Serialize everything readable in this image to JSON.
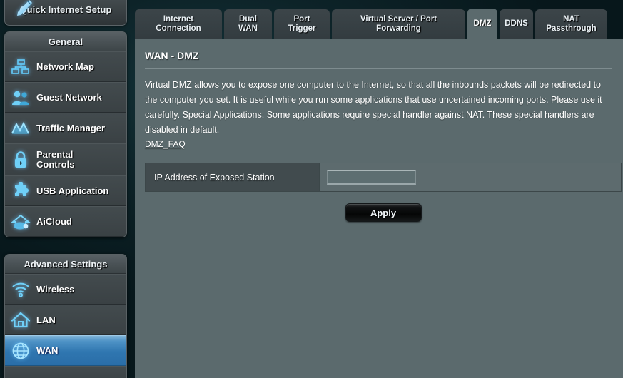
{
  "sidebar": {
    "quick_setup": {
      "label": "Quick Internet Setup",
      "icon": "wand-icon"
    },
    "groups": [
      {
        "header": "General",
        "items": [
          {
            "label": "Network Map",
            "icon": "network-map-icon",
            "active": false
          },
          {
            "label": "Guest Network",
            "icon": "guest-network-icon",
            "active": false
          },
          {
            "label": "Traffic Manager",
            "icon": "traffic-manager-icon",
            "active": false
          },
          {
            "label": "Parental\nControls",
            "icon": "padlock-icon",
            "active": false
          },
          {
            "label": "USB Application",
            "icon": "puzzle-piece-icon",
            "active": false
          },
          {
            "label": "AiCloud",
            "icon": "cloud-house-icon",
            "active": false
          }
        ]
      },
      {
        "header": "Advanced Settings",
        "items": [
          {
            "label": "Wireless",
            "icon": "wifi-icon",
            "active": false
          },
          {
            "label": "LAN",
            "icon": "house-icon",
            "active": false
          },
          {
            "label": "WAN",
            "icon": "globe-icon",
            "active": true
          }
        ]
      }
    ]
  },
  "tabs": [
    {
      "label": "Internet\nConnection",
      "active": false
    },
    {
      "label": "Dual\nWAN",
      "active": false
    },
    {
      "label": "Port\nTrigger",
      "active": false
    },
    {
      "label": "Virtual Server / Port\nForwarding",
      "active": false
    },
    {
      "label": "DMZ",
      "active": true
    },
    {
      "label": "DDNS",
      "active": false
    },
    {
      "label": "NAT\nPassthrough",
      "active": false
    }
  ],
  "page": {
    "title": "WAN - DMZ",
    "description": "Virtual DMZ allows you to expose one computer to the Internet, so that all the inbounds packets will be redirected to the computer you set. It is useful while you run some applications that use uncertained incoming ports. Please use it carefully. Special Applications: Some applications require special handler against NAT. These special handlers are disabled in default.",
    "faq_link": "DMZ_FAQ",
    "form": {
      "label": "IP Address of Exposed Station",
      "value": "",
      "placeholder": ""
    },
    "apply_label": "Apply"
  },
  "colors": {
    "panel_bg": "#5b6a6d",
    "tab_inactive": "#3c4549",
    "accent_blue": "#2f76b0",
    "icon_glow": "#6ec8ff"
  }
}
